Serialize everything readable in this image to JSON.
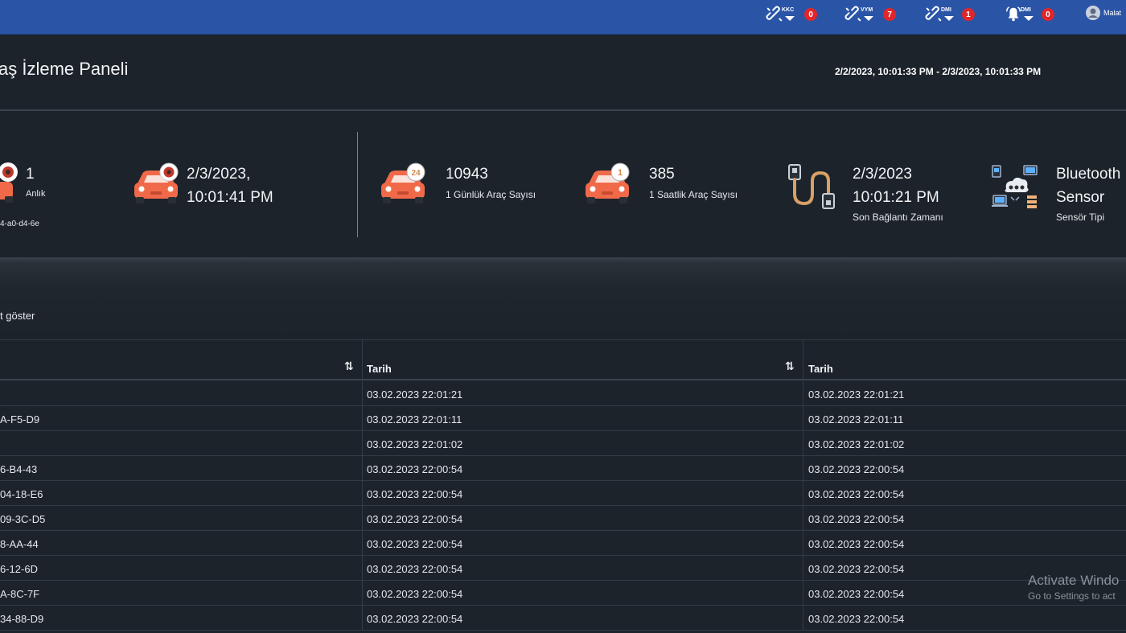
{
  "topbar": {
    "items": [
      {
        "label": "KKC",
        "count": "0",
        "icon": "broken-link-icon"
      },
      {
        "label": "VYM",
        "count": "7",
        "icon": "broken-link-icon"
      },
      {
        "label": "DMI",
        "count": "1",
        "icon": "broken-link-icon"
      },
      {
        "label": "DMI",
        "count": "0",
        "icon": "alarm-bell-icon"
      }
    ],
    "user": "Malat",
    "accent": "#2a55a6",
    "badge_color": "#e0262b"
  },
  "header": {
    "title": "aş İzleme Paneli",
    "date_range": "2/2/2023, 10:01:33 PM - 2/3/2023, 10:01:33 PM"
  },
  "stats": {
    "instant_value": "1",
    "instant_label": "Anlık",
    "device_id": "4-a0-d4-6e",
    "last_detection_line1": "2/3/2023,",
    "last_detection_line2": "10:01:41 PM",
    "daily_count": "10943",
    "daily_label": "1 Günlük Araç Sayısı",
    "daily_badge": "24",
    "hourly_count": "385",
    "hourly_label": "1 Saatlik Araç Sayısı",
    "hourly_badge": "1",
    "last_conn_line1": "2/3/2023",
    "last_conn_line2": "10:01:21 PM",
    "last_conn_label": "Son Bağlantı Zamanı",
    "sensor_line1": "Bluetooth",
    "sensor_line2": "Sensor",
    "sensor_label": "Sensör Tipi",
    "car_color": "#f06a4a"
  },
  "table": {
    "show_label": "t göster",
    "columns": [
      "",
      "Tarih",
      "Tarih"
    ],
    "rows": [
      {
        "id": "",
        "date1": "03.02.2023 22:01:21",
        "date2": "03.02.2023 22:01:21"
      },
      {
        "id": "A-F5-D9",
        "date1": "03.02.2023 22:01:11",
        "date2": "03.02.2023 22:01:11"
      },
      {
        "id": "",
        "date1": "03.02.2023 22:01:02",
        "date2": "03.02.2023 22:01:02"
      },
      {
        "id": "6-B4-43",
        "date1": "03.02.2023 22:00:54",
        "date2": "03.02.2023 22:00:54"
      },
      {
        "id": "04-18-E6",
        "date1": "03.02.2023 22:00:54",
        "date2": "03.02.2023 22:00:54"
      },
      {
        "id": "09-3C-D5",
        "date1": "03.02.2023 22:00:54",
        "date2": "03.02.2023 22:00:54"
      },
      {
        "id": "8-AA-44",
        "date1": "03.02.2023 22:00:54",
        "date2": "03.02.2023 22:00:54"
      },
      {
        "id": "6-12-6D",
        "date1": "03.02.2023 22:00:54",
        "date2": "03.02.2023 22:00:54"
      },
      {
        "id": "A-8C-7F",
        "date1": "03.02.2023 22:00:54",
        "date2": "03.02.2023 22:00:54"
      },
      {
        "id": "34-88-D9",
        "date1": "03.02.2023 22:00:54",
        "date2": "03.02.2023 22:00:54"
      }
    ]
  },
  "watermark": {
    "line1": "Activate Windo",
    "line2": "Go to Settings to act"
  }
}
